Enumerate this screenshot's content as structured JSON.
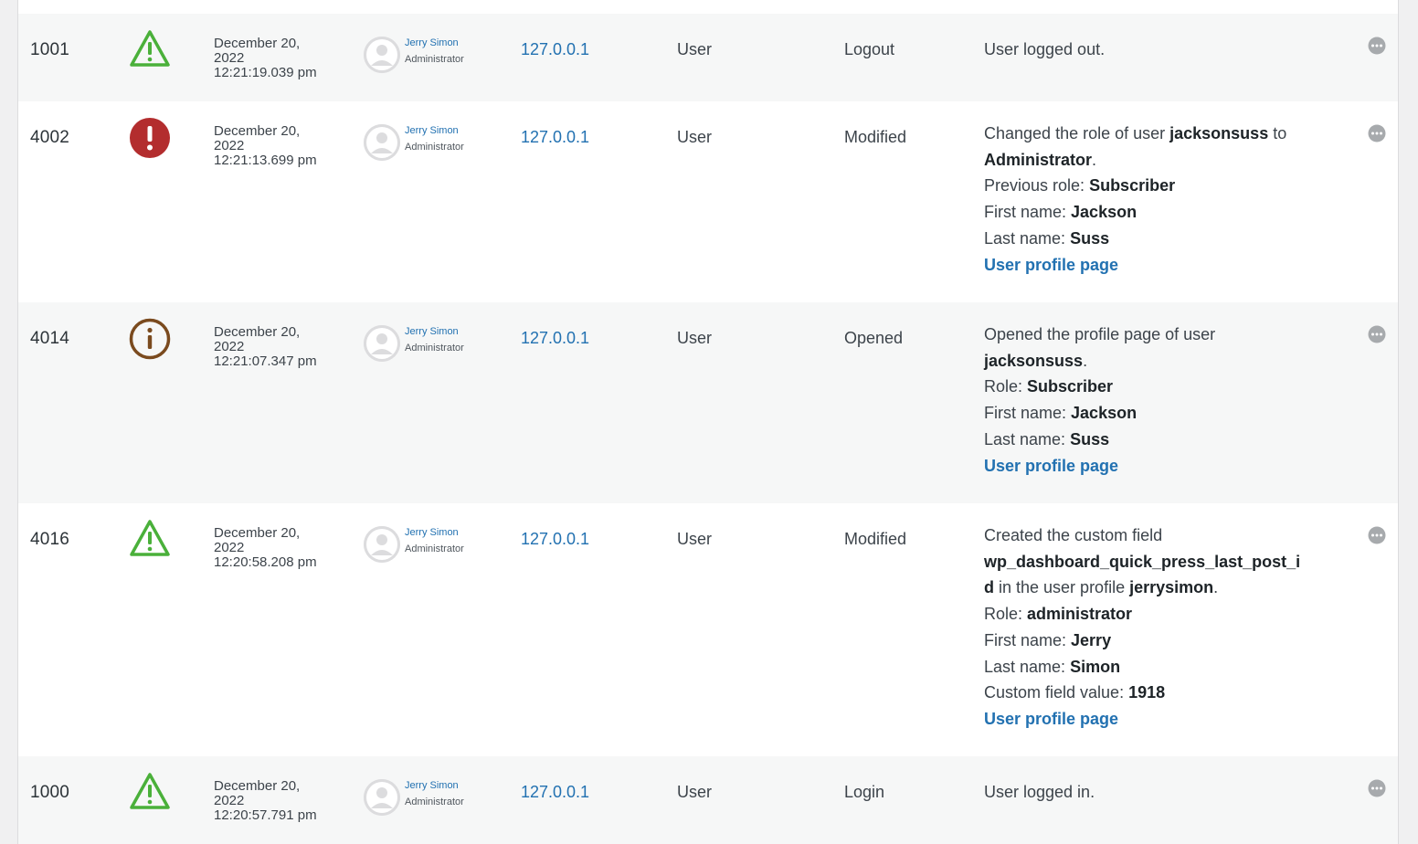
{
  "colors": {
    "warning": "#4ab03a",
    "critical": "#b32d2e",
    "info": "#7a4a1e",
    "link": "#2271b1",
    "more": "#a7aaad"
  },
  "rows": [
    {
      "id": "1001",
      "severity_icon": "warning-triangle-icon",
      "date": "December 20,",
      "year": "2022",
      "time": "12:21:19.039 pm",
      "user_name": "Jerry Simon",
      "user_role": "Administrator",
      "ip": "127.0.0.1",
      "object": "User",
      "event": "Logout",
      "message": {
        "lines": [
          [
            "User logged out."
          ]
        ]
      }
    },
    {
      "id": "4002",
      "severity_icon": "critical-exclamation-icon",
      "date": "December 20,",
      "year": "2022",
      "time": "12:21:13.699 pm",
      "user_name": "Jerry Simon",
      "user_role": "Administrator",
      "ip": "127.0.0.1",
      "object": "User",
      "event": "Modified",
      "message": {
        "line1_text": "Changed the role of user ",
        "line1_bold": "jacksonsuss",
        "line1_tail": " to",
        "line2_bold": "Administrator",
        "line2_tail": ".",
        "prev_role_label": "Previous role: ",
        "prev_role_value": "Subscriber",
        "first_label": "First name: ",
        "first_value": "Jackson",
        "last_label": "Last name: ",
        "last_value": "Suss",
        "link": "User profile page"
      }
    },
    {
      "id": "4014",
      "severity_icon": "info-circle-icon",
      "date": "December 20,",
      "year": "2022",
      "time": "12:21:07.347 pm",
      "user_name": "Jerry Simon",
      "user_role": "Administrator",
      "ip": "127.0.0.1",
      "object": "User",
      "event": "Opened",
      "message": {
        "line1_text": "Opened the profile page of user",
        "line2_bold": "jacksonsuss",
        "line2_tail": ".",
        "role_label": "Role: ",
        "role_value": "Subscriber",
        "first_label": "First name: ",
        "first_value": "Jackson",
        "last_label": "Last name: ",
        "last_value": "Suss",
        "link": "User profile page"
      }
    },
    {
      "id": "4016",
      "severity_icon": "warning-triangle-icon",
      "date": "December 20,",
      "year": "2022",
      "time": "12:20:58.208 pm",
      "user_name": "Jerry Simon",
      "user_role": "Administrator",
      "ip": "127.0.0.1",
      "object": "User",
      "event": "Modified",
      "message": {
        "line1_text": "Created the custom field",
        "field_bold_a": "wp_dashboard_quick_press_last_post_i",
        "field_bold_b": "d",
        "profile_text": " in the user profile ",
        "profile_bold": "jerrysimon",
        "profile_tail": ".",
        "role_label": "Role: ",
        "role_value": "administrator",
        "first_label": "First name: ",
        "first_value": "Jerry",
        "last_label": "Last name: ",
        "last_value": "Simon",
        "cf_label": "Custom field value: ",
        "cf_value": "1918",
        "link": "User profile page"
      }
    },
    {
      "id": "1000",
      "severity_icon": "warning-triangle-icon",
      "date": "December 20,",
      "year": "2022",
      "time": "12:20:57.791 pm",
      "user_name": "Jerry Simon",
      "user_role": "Administrator",
      "ip": "127.0.0.1",
      "object": "User",
      "event": "Login",
      "message": {
        "lines": [
          [
            "User logged in."
          ]
        ]
      }
    }
  ]
}
